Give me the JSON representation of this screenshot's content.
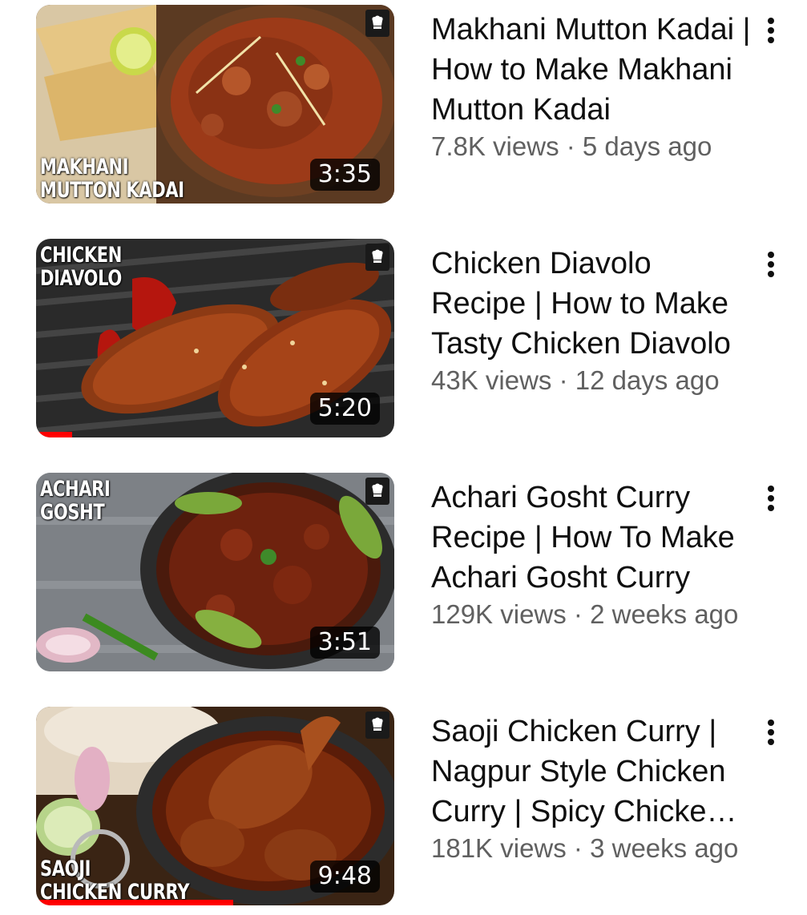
{
  "videos": [
    {
      "title": "Makhani Mutton Kadai | How to Make Makhani Mutton Kadai",
      "views": "7.8K views",
      "age": "5 days ago",
      "duration": "3:35",
      "overlay_lines": [
        "MAKHANI",
        "MUTTON KADAI"
      ],
      "overlay_position": "bottom",
      "watched_fraction": 0
    },
    {
      "title": "Chicken Diavolo Recipe | How to Make Tasty Chicken Diavolo",
      "views": "43K views",
      "age": "12 days ago",
      "duration": "5:20",
      "overlay_lines": [
        "CHICKEN",
        "DIAVOLO"
      ],
      "overlay_position": "top",
      "watched_fraction": 0.1
    },
    {
      "title": "Achari Gosht Curry Recipe | How To Make Achari Gosht Curry",
      "views": "129K views",
      "age": "2 weeks ago",
      "duration": "3:51",
      "overlay_lines": [
        "ACHARI",
        "GOSHT"
      ],
      "overlay_position": "top",
      "watched_fraction": 0
    },
    {
      "title": "Saoji Chicken Curry | Nagpur Style Chicken Curry | Spicy Chicken Curry",
      "views": "181K views",
      "age": "3 weeks ago",
      "duration": "9:48",
      "overlay_lines": [
        "SAOJI",
        "CHICKEN CURRY"
      ],
      "overlay_position": "bottom",
      "watched_fraction": 0.55
    }
  ],
  "colors": {
    "progress": "#ff0000",
    "title": "#0f0f0f",
    "meta": "#606060"
  },
  "icons": {
    "menu": "more-vert-icon",
    "channel": "chef-hat-logo-icon"
  }
}
